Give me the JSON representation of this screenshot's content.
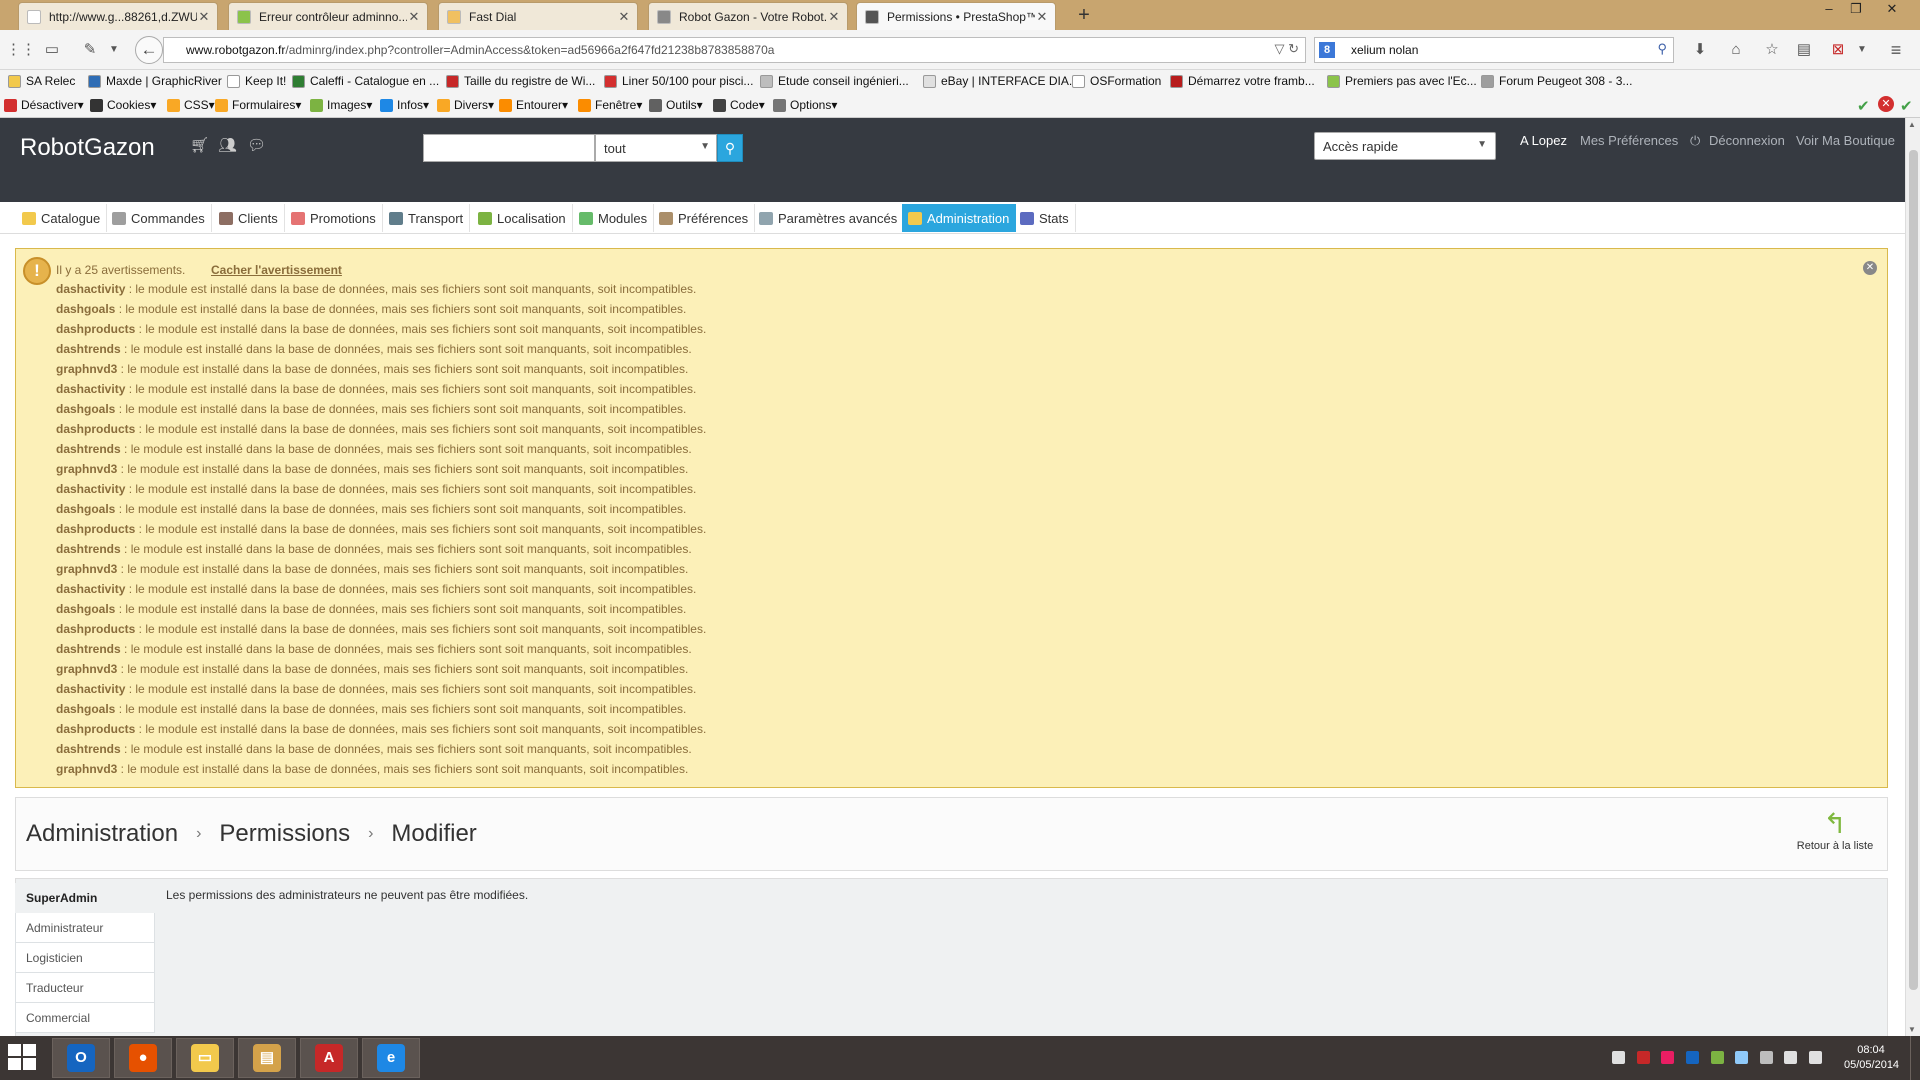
{
  "browser": {
    "tabs": [
      {
        "title": "http://www.g...88261,d.ZWU",
        "favicon_color": "#ffffff"
      },
      {
        "title": "Erreur contrôleur adminno...",
        "favicon_color": "#8bc34a"
      },
      {
        "title": "Fast Dial",
        "favicon_color": "#f0c060"
      },
      {
        "title": "Robot Gazon - Votre Robot...",
        "favicon_color": "#888888"
      },
      {
        "title": "Permissions • PrestaShop™",
        "favicon_color": "#555555"
      }
    ],
    "new_tab": "+",
    "window_controls": {
      "minimize": "–",
      "restore": "❐",
      "close": "✕"
    },
    "url": {
      "domain": "www.robotgazon.fr",
      "path": "/adminrg/index.php?controller=AdminAccess&token=ad56966a2f647fd21238b8783858870a"
    },
    "search_engine_label": "8",
    "search_value": "xelium nolan",
    "bookmarks": [
      {
        "label": "SA Relec",
        "color": "#f2c94c"
      },
      {
        "label": "Maxde | GraphicRiver",
        "color": "#2f6db5"
      },
      {
        "label": "Keep It!",
        "color": "#ffffff"
      },
      {
        "label": "Caleffi - Catalogue en ...",
        "color": "#2e7d32"
      },
      {
        "label": "Taille du registre de Wi...",
        "color": "#c62828"
      },
      {
        "label": "Liner 50/100 pour pisci...",
        "color": "#d32f2f"
      },
      {
        "label": "Etude conseil ingénieri...",
        "color": "#bdbdbd"
      },
      {
        "label": "eBay | INTERFACE DIA...",
        "color": "#e0e0e0"
      },
      {
        "label": "OSFormation",
        "color": "#ffffff"
      },
      {
        "label": "Démarrez votre framb...",
        "color": "#b71c1c"
      },
      {
        "label": "Premiers pas avec l'Ec...",
        "color": "#8bc34a"
      },
      {
        "label": "Forum Peugeot 308 - 3...",
        "color": "#9e9e9e"
      }
    ],
    "devtools": [
      {
        "label": "Désactiver▾",
        "color": "#d32f2f"
      },
      {
        "label": "Cookies▾",
        "color": "#333333"
      },
      {
        "label": "CSS▾",
        "color": "#f9a825"
      },
      {
        "label": "Formulaires▾",
        "color": "#f9a825"
      },
      {
        "label": "Images▾",
        "color": "#7cb342"
      },
      {
        "label": "Infos▾",
        "color": "#1e88e5"
      },
      {
        "label": "Divers▾",
        "color": "#f9a825"
      },
      {
        "label": "Entourer▾",
        "color": "#fb8c00"
      },
      {
        "label": "Fenêtre▾",
        "color": "#fb8c00"
      },
      {
        "label": "Outils▾",
        "color": "#616161"
      },
      {
        "label": "Code▾",
        "color": "#424242"
      },
      {
        "label": "Options▾",
        "color": "#757575"
      }
    ]
  },
  "header": {
    "brand": "RobotGazon",
    "search_scope": "tout",
    "quick_access": "Accès rapide",
    "user": "A Lopez",
    "preferences": "Mes Préférences",
    "logout": "Déconnexion",
    "shop": "Voir Ma Boutique"
  },
  "menu": [
    {
      "label": "Catalogue",
      "color": "#f2c94c"
    },
    {
      "label": "Commandes",
      "color": "#9e9e9e"
    },
    {
      "label": "Clients",
      "color": "#8d6e63"
    },
    {
      "label": "Promotions",
      "color": "#e57373"
    },
    {
      "label": "Transport",
      "color": "#607d8b"
    },
    {
      "label": "Localisation",
      "color": "#7cb342"
    },
    {
      "label": "Modules",
      "color": "#66bb6a"
    },
    {
      "label": "Préférences",
      "color": "#ab8f6a"
    },
    {
      "label": "Paramètres avancés",
      "color": "#90a4ae"
    },
    {
      "label": "Administration",
      "color": "#f2c94c"
    },
    {
      "label": "Stats",
      "color": "#5c6bc0"
    }
  ],
  "warning": {
    "count_text": "Il y a 25 avertissements.",
    "hide_label": "Cacher l'avertissement",
    "items": [
      {
        "module": "dashactivity",
        "message": " : le module est installé dans la base de données, mais ses fichiers sont soit manquants, soit incompatibles."
      },
      {
        "module": "dashgoals",
        "message": " : le module est installé dans la base de données, mais ses fichiers sont soit manquants, soit incompatibles."
      },
      {
        "module": "dashproducts",
        "message": " : le module est installé dans la base de données, mais ses fichiers sont soit manquants, soit incompatibles."
      },
      {
        "module": "dashtrends",
        "message": " : le module est installé dans la base de données, mais ses fichiers sont soit manquants, soit incompatibles."
      },
      {
        "module": "graphnvd3",
        "message": " : le module est installé dans la base de données, mais ses fichiers sont soit manquants, soit incompatibles."
      },
      {
        "module": "dashactivity",
        "message": " : le module est installé dans la base de données, mais ses fichiers sont soit manquants, soit incompatibles."
      },
      {
        "module": "dashgoals",
        "message": " : le module est installé dans la base de données, mais ses fichiers sont soit manquants, soit incompatibles."
      },
      {
        "module": "dashproducts",
        "message": " : le module est installé dans la base de données, mais ses fichiers sont soit manquants, soit incompatibles."
      },
      {
        "module": "dashtrends",
        "message": " : le module est installé dans la base de données, mais ses fichiers sont soit manquants, soit incompatibles."
      },
      {
        "module": "graphnvd3",
        "message": " : le module est installé dans la base de données, mais ses fichiers sont soit manquants, soit incompatibles."
      },
      {
        "module": "dashactivity",
        "message": " : le module est installé dans la base de données, mais ses fichiers sont soit manquants, soit incompatibles."
      },
      {
        "module": "dashgoals",
        "message": " : le module est installé dans la base de données, mais ses fichiers sont soit manquants, soit incompatibles."
      },
      {
        "module": "dashproducts",
        "message": " : le module est installé dans la base de données, mais ses fichiers sont soit manquants, soit incompatibles."
      },
      {
        "module": "dashtrends",
        "message": " : le module est installé dans la base de données, mais ses fichiers sont soit manquants, soit incompatibles."
      },
      {
        "module": "graphnvd3",
        "message": " : le module est installé dans la base de données, mais ses fichiers sont soit manquants, soit incompatibles."
      },
      {
        "module": "dashactivity",
        "message": " : le module est installé dans la base de données, mais ses fichiers sont soit manquants, soit incompatibles."
      },
      {
        "module": "dashgoals",
        "message": " : le module est installé dans la base de données, mais ses fichiers sont soit manquants, soit incompatibles."
      },
      {
        "module": "dashproducts",
        "message": " : le module est installé dans la base de données, mais ses fichiers sont soit manquants, soit incompatibles."
      },
      {
        "module": "dashtrends",
        "message": " : le module est installé dans la base de données, mais ses fichiers sont soit manquants, soit incompatibles."
      },
      {
        "module": "graphnvd3",
        "message": " : le module est installé dans la base de données, mais ses fichiers sont soit manquants, soit incompatibles."
      },
      {
        "module": "dashactivity",
        "message": " : le module est installé dans la base de données, mais ses fichiers sont soit manquants, soit incompatibles."
      },
      {
        "module": "dashgoals",
        "message": " : le module est installé dans la base de données, mais ses fichiers sont soit manquants, soit incompatibles."
      },
      {
        "module": "dashproducts",
        "message": " : le module est installé dans la base de données, mais ses fichiers sont soit manquants, soit incompatibles."
      },
      {
        "module": "dashtrends",
        "message": " : le module est installé dans la base de données, mais ses fichiers sont soit manquants, soit incompatibles."
      },
      {
        "module": "graphnvd3",
        "message": " : le module est installé dans la base de données, mais ses fichiers sont soit manquants, soit incompatibles."
      }
    ]
  },
  "page": {
    "breadcrumb": [
      "Administration",
      "Permissions",
      "Modifier"
    ],
    "back_label": "Retour à la liste",
    "profiles": [
      "SuperAdmin",
      "Administrateur",
      "Logisticien",
      "Traducteur",
      "Commercial"
    ],
    "active_profile": "SuperAdmin",
    "message": "Les permissions des administrateurs ne peuvent pas être modifiées."
  },
  "taskbar": {
    "apps": [
      {
        "name": "outlook",
        "color": "#1565c0",
        "glyph": "O"
      },
      {
        "name": "firefox",
        "color": "#e65100",
        "glyph": "●"
      },
      {
        "name": "folder",
        "color": "#f2c94c",
        "glyph": "▭"
      },
      {
        "name": "explorer",
        "color": "#d4a24a",
        "glyph": "▤"
      },
      {
        "name": "acrobat",
        "color": "#c62828",
        "glyph": "A"
      },
      {
        "name": "internet-explorer",
        "color": "#1e88e5",
        "glyph": "e"
      }
    ],
    "time": "08:04",
    "date": "05/05/2014"
  }
}
